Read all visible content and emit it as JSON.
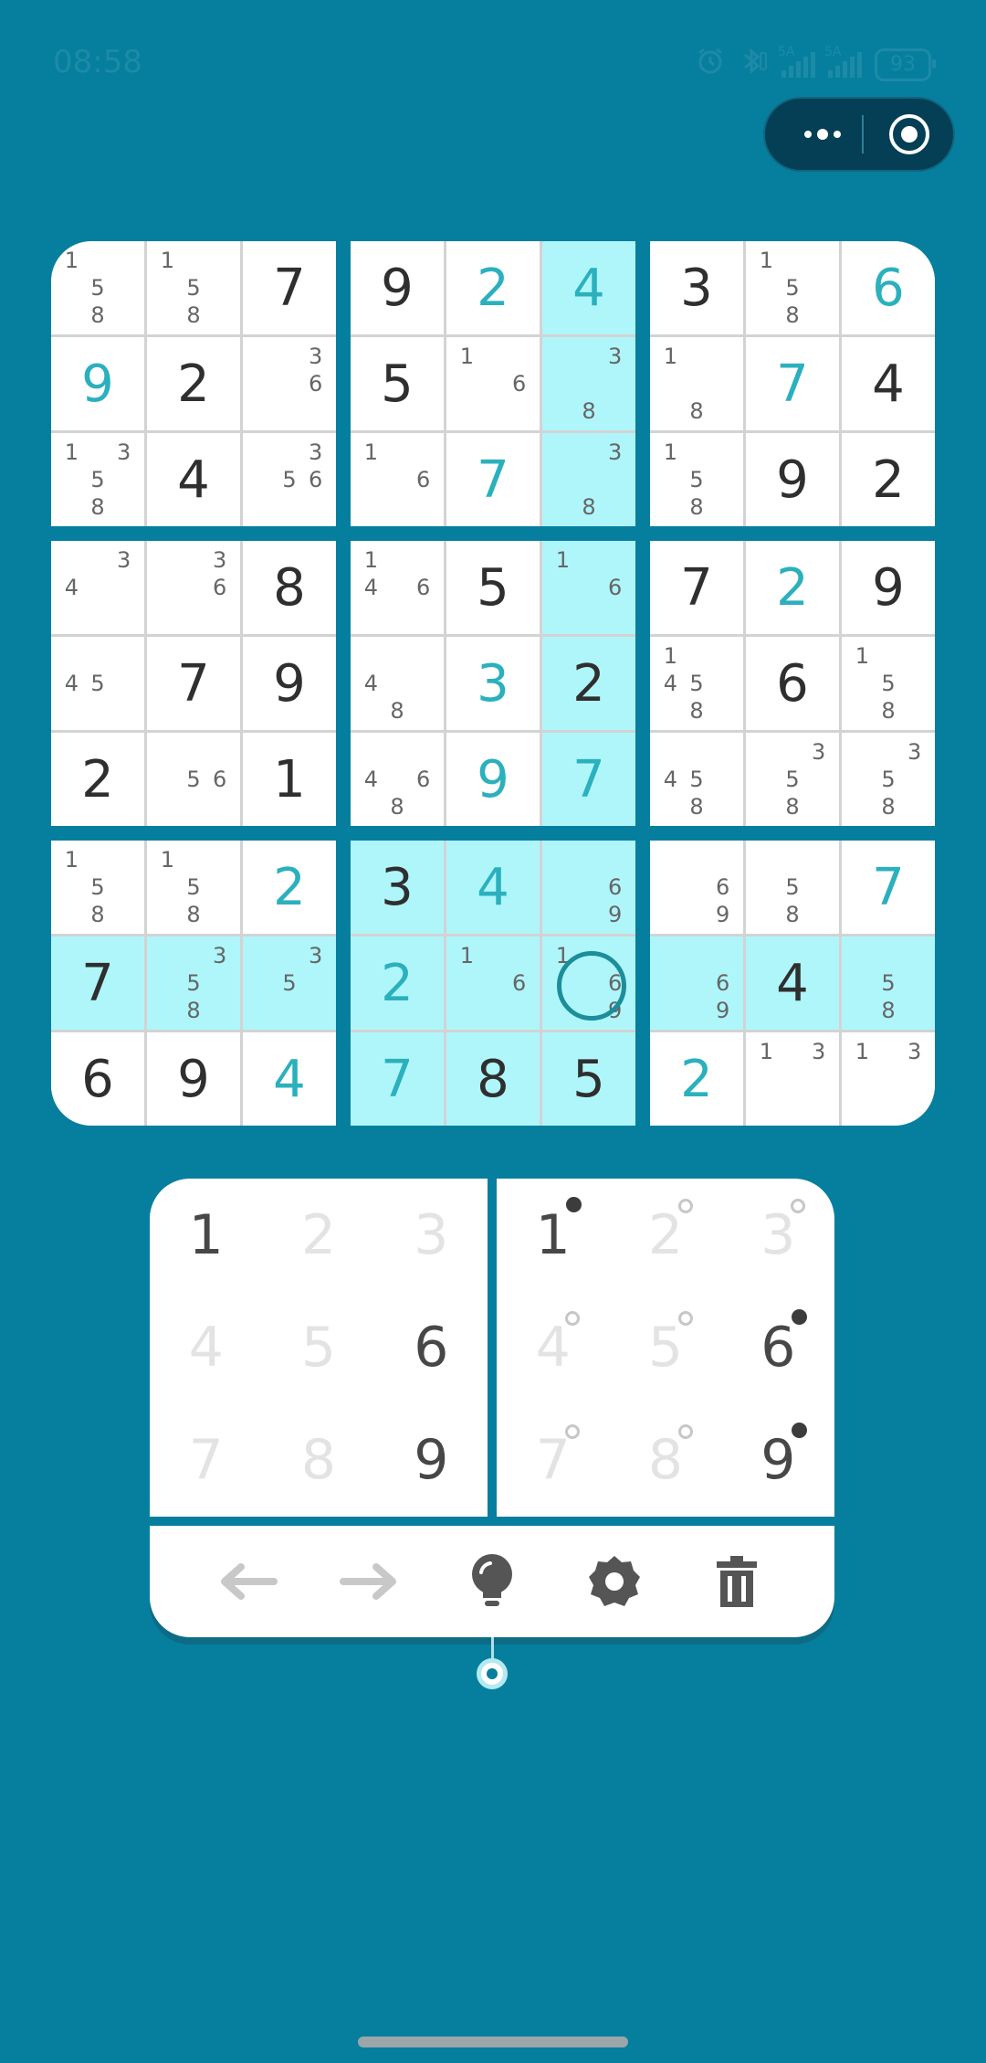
{
  "status_bar": {
    "time": "08:58",
    "battery": "93",
    "network_label_1": "5A",
    "network_label_2": "5A"
  },
  "colors": {
    "background": "#067f9e",
    "highlight": "#aff6fb",
    "user_digit": "#2bb0bd",
    "given_digit": "#2f2f2f"
  },
  "board": {
    "rows": [
      [
        {
          "v": "",
          "n": "158"
        },
        {
          "v": "",
          "n": "158"
        },
        {
          "v": "7",
          "t": "given"
        },
        {
          "v": "9",
          "t": "given"
        },
        {
          "v": "2",
          "t": "user"
        },
        {
          "v": "4",
          "t": "user",
          "h": true
        },
        {
          "v": "3",
          "t": "given"
        },
        {
          "v": "",
          "n": "158"
        },
        {
          "v": "6",
          "t": "user"
        }
      ],
      [
        {
          "v": "9",
          "t": "user"
        },
        {
          "v": "2",
          "t": "given"
        },
        {
          "v": "",
          "n": "36"
        },
        {
          "v": "5",
          "t": "given"
        },
        {
          "v": "",
          "n": "16"
        },
        {
          "v": "",
          "n": "38",
          "h": true
        },
        {
          "v": "",
          "n": "18"
        },
        {
          "v": "7",
          "t": "user"
        },
        {
          "v": "4",
          "t": "given"
        }
      ],
      [
        {
          "v": "",
          "n": "1358"
        },
        {
          "v": "4",
          "t": "given"
        },
        {
          "v": "",
          "n": "356"
        },
        {
          "v": "",
          "n": "16"
        },
        {
          "v": "7",
          "t": "user"
        },
        {
          "v": "",
          "n": "38",
          "h": true
        },
        {
          "v": "",
          "n": "158"
        },
        {
          "v": "9",
          "t": "given"
        },
        {
          "v": "2",
          "t": "given"
        }
      ],
      [
        {
          "v": "",
          "n": "34"
        },
        {
          "v": "",
          "n": "36"
        },
        {
          "v": "8",
          "t": "given"
        },
        {
          "v": "",
          "n": "146"
        },
        {
          "v": "5",
          "t": "given"
        },
        {
          "v": "",
          "n": "16",
          "h": true
        },
        {
          "v": "7",
          "t": "given"
        },
        {
          "v": "2",
          "t": "user"
        },
        {
          "v": "9",
          "t": "given"
        }
      ],
      [
        {
          "v": "",
          "n": "45"
        },
        {
          "v": "7",
          "t": "given"
        },
        {
          "v": "9",
          "t": "given"
        },
        {
          "v": "",
          "n": "48"
        },
        {
          "v": "3",
          "t": "user"
        },
        {
          "v": "2",
          "t": "given",
          "h": true
        },
        {
          "v": "",
          "n": "1458"
        },
        {
          "v": "6",
          "t": "given"
        },
        {
          "v": "",
          "n": "158"
        }
      ],
      [
        {
          "v": "2",
          "t": "given"
        },
        {
          "v": "",
          "n": "56"
        },
        {
          "v": "1",
          "t": "given"
        },
        {
          "v": "",
          "n": "468"
        },
        {
          "v": "9",
          "t": "user"
        },
        {
          "v": "7",
          "t": "user",
          "h": true
        },
        {
          "v": "",
          "n": "458"
        },
        {
          "v": "",
          "n": "358"
        },
        {
          "v": "",
          "n": "358"
        }
      ],
      [
        {
          "v": "",
          "n": "158"
        },
        {
          "v": "",
          "n": "158"
        },
        {
          "v": "2",
          "t": "user"
        },
        {
          "v": "3",
          "t": "given",
          "h": true
        },
        {
          "v": "4",
          "t": "user",
          "h": true
        },
        {
          "v": "",
          "n": "69",
          "h": true
        },
        {
          "v": "",
          "n": "69"
        },
        {
          "v": "",
          "n": "58"
        },
        {
          "v": "7",
          "t": "user"
        }
      ],
      [
        {
          "v": "7",
          "t": "given",
          "h": true
        },
        {
          "v": "",
          "n": "358",
          "h": true
        },
        {
          "v": "",
          "n": "35",
          "h": true
        },
        {
          "v": "2",
          "t": "user",
          "h": true
        },
        {
          "v": "",
          "n": "16",
          "h": true
        },
        {
          "v": "",
          "n": "169",
          "h": true,
          "sel": true
        },
        {
          "v": "",
          "n": "69",
          "h": true
        },
        {
          "v": "4",
          "t": "given",
          "h": true
        },
        {
          "v": "",
          "n": "58",
          "h": true
        }
      ],
      [
        {
          "v": "6",
          "t": "given"
        },
        {
          "v": "9",
          "t": "given"
        },
        {
          "v": "4",
          "t": "user"
        },
        {
          "v": "7",
          "t": "user",
          "h": true
        },
        {
          "v": "8",
          "t": "given",
          "h": true
        },
        {
          "v": "5",
          "t": "given",
          "h": true
        },
        {
          "v": "2",
          "t": "user"
        },
        {
          "v": "",
          "n": "13"
        },
        {
          "v": "",
          "n": "13"
        }
      ]
    ]
  },
  "number_pad": {
    "keys": [
      {
        "d": "1",
        "state": "active"
      },
      {
        "d": "2",
        "state": "dim"
      },
      {
        "d": "3",
        "state": "dim"
      },
      {
        "d": "4",
        "state": "dim"
      },
      {
        "d": "5",
        "state": "dim"
      },
      {
        "d": "6",
        "state": "active"
      },
      {
        "d": "7",
        "state": "dim"
      },
      {
        "d": "8",
        "state": "dim"
      },
      {
        "d": "9",
        "state": "active"
      }
    ]
  },
  "note_pad": {
    "keys": [
      {
        "d": "1",
        "state": "active",
        "mark": "filled"
      },
      {
        "d": "2",
        "state": "dim",
        "mark": "open"
      },
      {
        "d": "3",
        "state": "dim",
        "mark": "open"
      },
      {
        "d": "4",
        "state": "dim",
        "mark": "open"
      },
      {
        "d": "5",
        "state": "dim",
        "mark": "open"
      },
      {
        "d": "6",
        "state": "active",
        "mark": "filled"
      },
      {
        "d": "7",
        "state": "dim",
        "mark": "open"
      },
      {
        "d": "8",
        "state": "dim",
        "mark": "open"
      },
      {
        "d": "9",
        "state": "active",
        "mark": "filled"
      }
    ]
  },
  "toolbar": {
    "icons": [
      "undo-arrow-icon",
      "redo-arrow-icon",
      "hint-bulb-icon",
      "settings-gear-icon",
      "trash-icon"
    ]
  }
}
